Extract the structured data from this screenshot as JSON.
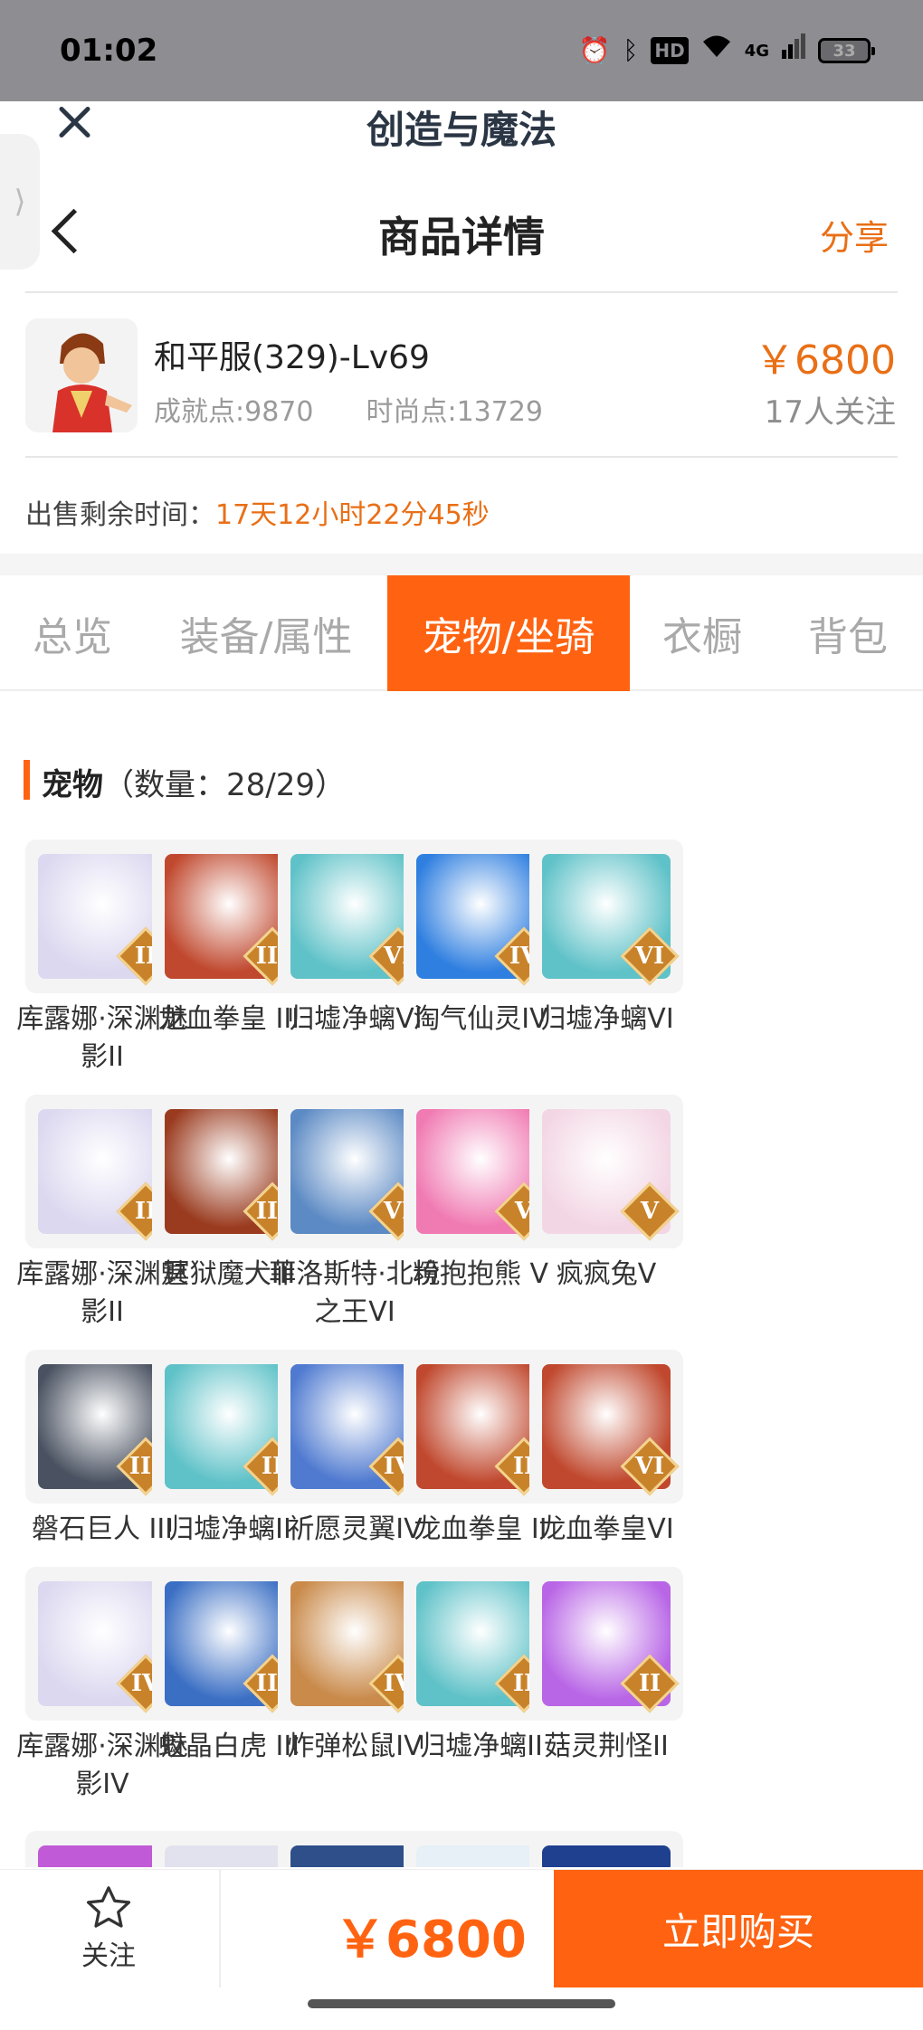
{
  "status_bar": {
    "time": "01:02",
    "hd": "HD",
    "network": "4G",
    "battery": "33"
  },
  "webview": {
    "title": "创造与魔法"
  },
  "header": {
    "title": "商品详情",
    "share": "分享"
  },
  "product": {
    "name": "和平服(329)-Lv69",
    "achievement": "成就点:9870",
    "fashion": "时尚点:13729",
    "price": "￥6800",
    "watchers": "17人关注",
    "remain_label": "出售剩余时间：",
    "remain_time": "17天12小时22分45秒"
  },
  "tabs": [
    {
      "label": "总览"
    },
    {
      "label": "装备/属性"
    },
    {
      "label": "宠物/坐骑"
    },
    {
      "label": "衣橱"
    },
    {
      "label": "背包"
    }
  ],
  "section": {
    "title": "宠物",
    "count": "（数量：28/29）"
  },
  "pets": [
    {
      "name": "库露娜·深渊魅影II",
      "tier": "II",
      "color": "#dcd8f0"
    },
    {
      "name": "龙血拳皇 III",
      "tier": "III",
      "color": "#c0482e"
    },
    {
      "name": "归墟净螭VI",
      "tier": "VI",
      "color": "#5fc2c8"
    },
    {
      "name": "淘气仙灵IV",
      "tier": "IV",
      "color": "#2f7fe0"
    },
    {
      "name": "归墟净螭VI",
      "tier": "VI",
      "color": "#5fc2c8"
    },
    {
      "name": "库露娜·深渊魅影II",
      "tier": "II",
      "color": "#dcd8f0"
    },
    {
      "name": "冥狱魔犬III",
      "tier": "III",
      "color": "#9a3b1f"
    },
    {
      "name": "菲洛斯特·北境之王VI",
      "tier": "VI",
      "color": "#5c8ac4"
    },
    {
      "name": "粉抱抱熊 V",
      "tier": "V",
      "color": "#f07ab2"
    },
    {
      "name": "疯疯兔V",
      "tier": "V",
      "color": "#f3d6e4"
    },
    {
      "name": "磐石巨人 III",
      "tier": "III",
      "color": "#4a5261"
    },
    {
      "name": "归墟净螭II",
      "tier": "II",
      "color": "#5fc2c8"
    },
    {
      "name": "祈愿灵翼IV",
      "tier": "IV",
      "color": "#4f7ad0"
    },
    {
      "name": "龙血拳皇 II",
      "tier": "II",
      "color": "#c0482e"
    },
    {
      "name": "龙血拳皇VI",
      "tier": "VI",
      "color": "#c0482e"
    },
    {
      "name": "库露娜·深渊魅影IV",
      "tier": "IV",
      "color": "#dcd8f0"
    },
    {
      "name": "蛟晶白虎 III",
      "tier": "III",
      "color": "#3b6fc4"
    },
    {
      "name": "炸弹松鼠IV",
      "tier": "IV",
      "color": "#c98a4a"
    },
    {
      "name": "归墟净螭II",
      "tier": "II",
      "color": "#5fc2c8"
    },
    {
      "name": "菇灵荆怪II",
      "tier": "II",
      "color": "#b865e6"
    }
  ],
  "partial_colors": [
    "#c05ad6",
    "#e2e2ee",
    "#2e4f8a",
    "#e6f0f6",
    "#1f3f8f"
  ],
  "bottom": {
    "follow": "关注",
    "price": "￥6800",
    "buy": "立即购买"
  },
  "colors": {
    "accent": "#ff6311",
    "price": "#e96f16"
  }
}
